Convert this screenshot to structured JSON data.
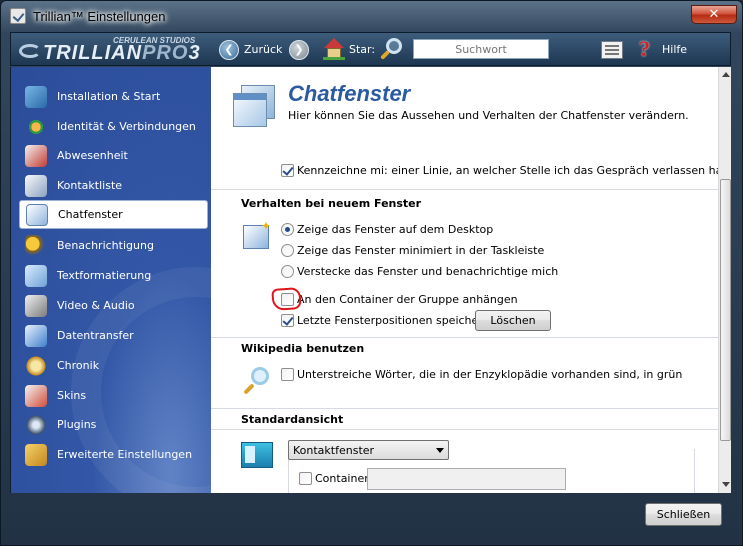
{
  "window": {
    "title": "Trillian™ Einstellungen",
    "close_symbol": "✕"
  },
  "toolbar": {
    "logo_brand": "TRILLIAN",
    "logo_pro": "PRO",
    "logo_version": "3",
    "logo_sub": "CERULEAN STUDIOS",
    "back_label": "Zurück",
    "star_label": "Star:",
    "search_placeholder": "Suchwort",
    "help_label": "Hilfe",
    "back_symbol": "❮",
    "forward_symbol": "❯",
    "help_symbol": "?"
  },
  "sidebar": {
    "items": [
      {
        "label": "Installation & Start",
        "icon": "monitor-icon"
      },
      {
        "label": "Identität & Verbindungen",
        "icon": "network-icon"
      },
      {
        "label": "Abwesenheit",
        "icon": "away-icon"
      },
      {
        "label": "Kontaktliste",
        "icon": "contacts-icon"
      },
      {
        "label": "Chatfenster",
        "icon": "chat-window-icon",
        "active": true
      },
      {
        "label": "Benachrichtigung",
        "icon": "bell-icon"
      },
      {
        "label": "Textformatierung",
        "icon": "text-format-icon"
      },
      {
        "label": "Video & Audio",
        "icon": "microphone-icon"
      },
      {
        "label": "Datentransfer",
        "icon": "transfer-icon"
      },
      {
        "label": "Chronik",
        "icon": "history-icon"
      },
      {
        "label": "Skins",
        "icon": "brush-icon"
      },
      {
        "label": "Plugins",
        "icon": "plugin-icon"
      },
      {
        "label": "Erweiterte Einstellungen",
        "icon": "toolbox-icon"
      }
    ]
  },
  "content": {
    "title": "Chatfenster",
    "subtitle": "Hier können Sie das Aussehen und Verhalten der Chatfenster verändern.",
    "mark_line_label": "Kennzeichne mi: einer Linie, an welcher Stelle ich das Gespräch verlassen habe",
    "mark_line_checked": true,
    "section_new_window": "Verhalten bei neuem Fenster",
    "radio_options": [
      {
        "label": "Zeige das Fenster auf dem Desktop",
        "checked": true
      },
      {
        "label": "Zeige das Fenster minimiert in der Taskleiste",
        "checked": false
      },
      {
        "label": "Verstecke das Fenster und benachrichtige mich",
        "checked": false
      }
    ],
    "container_group_label": "An den Container der Gruppe anhängen",
    "container_group_checked": false,
    "save_positions_label": "Letzte Fensterpositionen speichern",
    "save_positions_checked": true,
    "delete_button": "Löschen",
    "section_wikipedia": "Wikipedia benutzen",
    "wikipedia_label": "Unterstreiche Wörter, die in der Enzyklopädie vorhanden sind, in grün",
    "wikipedia_checked": false,
    "section_default_view": "Standardansicht",
    "default_view_value": "Kontaktfenster",
    "container_label": "Container",
    "container_checked": false,
    "container_input_value": ""
  },
  "footer": {
    "close_button": "Schließen"
  },
  "colors": {
    "accent": "#2a5aa0",
    "sidebar_bg": "#3357a6",
    "annotation_red": "#e0141b"
  }
}
